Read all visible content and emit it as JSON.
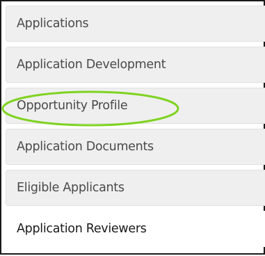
{
  "menu": {
    "items": [
      {
        "label": "Applications",
        "active": false
      },
      {
        "label": "Application Development",
        "active": false
      },
      {
        "label": "Opportunity Profile",
        "active": false,
        "highlighted": true
      },
      {
        "label": "Application Documents",
        "active": false
      },
      {
        "label": "Eligible Applicants",
        "active": false
      },
      {
        "label": "Application Reviewers",
        "active": true
      }
    ]
  },
  "colors": {
    "item_background": "#efefef",
    "active_background": "#ffffff",
    "highlight_stroke": "#7fd321",
    "frame_border": "#1a1a1a"
  }
}
